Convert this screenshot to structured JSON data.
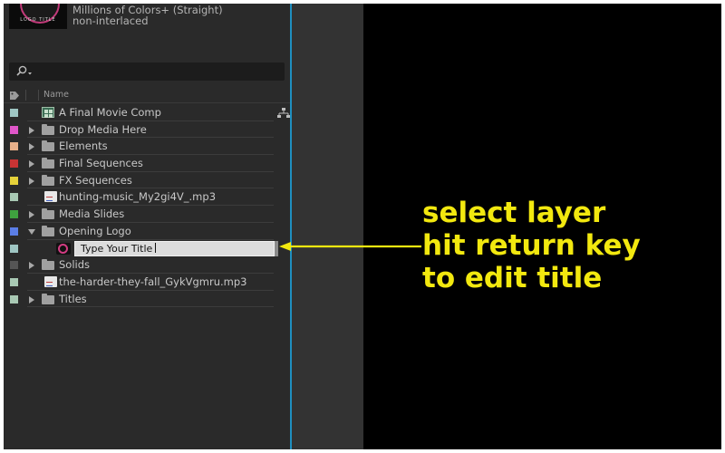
{
  "preview": {
    "color_depth": "Millions of Colors+ (Straight)",
    "scan": "non-interlaced",
    "thumb_text": "LOGO TITLE"
  },
  "search": {
    "placeholder": ""
  },
  "columns": {
    "name": "Name"
  },
  "items": [
    {
      "name": "A Final Movie Comp",
      "type": "comp",
      "label_color": "#9fc6c3"
    },
    {
      "name": "Drop Media Here",
      "type": "folder",
      "label_color": "#e056c9"
    },
    {
      "name": "Elements",
      "type": "folder",
      "label_color": "#e8b08a"
    },
    {
      "name": "Final Sequences",
      "type": "folder",
      "label_color": "#c83434"
    },
    {
      "name": "FX Sequences",
      "type": "folder",
      "label_color": "#e6d23a"
    },
    {
      "name": "hunting-music_My2gi4V_.mp3",
      "type": "audio",
      "label_color": "#a9c9b4"
    },
    {
      "name": "Media Slides",
      "type": "folder",
      "label_color": "#3fa13f"
    },
    {
      "name": "Opening Logo",
      "type": "folder-open",
      "label_color": "#5b7ee6"
    },
    {
      "name": "Type Your Title",
      "type": "layer-editing",
      "label_color": "#9fc6c3"
    },
    {
      "name": "Solids",
      "type": "folder",
      "label_color": "#555555"
    },
    {
      "name": "the-harder-they-fall_GykVgmru.mp3",
      "type": "audio",
      "label_color": "#a9c9b4"
    },
    {
      "name": "Titles",
      "type": "folder",
      "label_color": "#a9c9b4"
    }
  ],
  "annotation": {
    "line1": "select layer",
    "line2": "hit return key",
    "line3": "to edit title",
    "color": "#f2e80f"
  },
  "colors": {
    "panel": "#2a2a2a",
    "divider": "#1f8fc0",
    "viewer": "#000000"
  }
}
